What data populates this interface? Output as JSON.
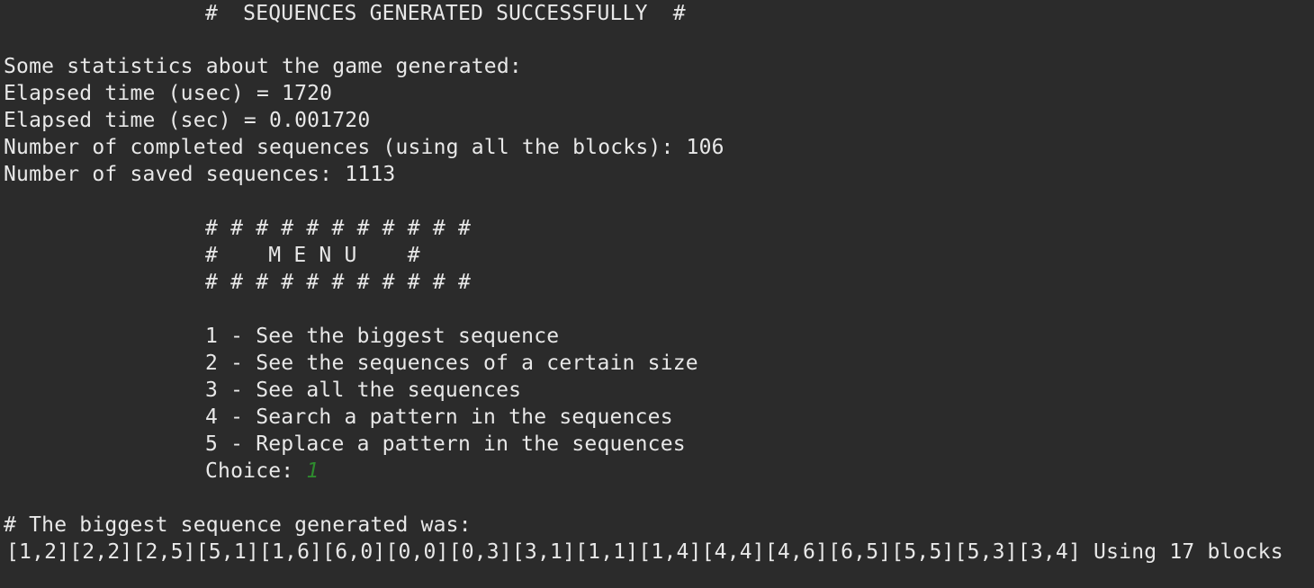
{
  "terminal": {
    "header": "#  SEQUENCES GENERATED SUCCESSFULLY  #",
    "stats": {
      "heading": "Some statistics about the game generated:",
      "usec_line": "Elapsed time (usec) = 1720",
      "sec_line": "Elapsed time (sec) = 0.001720",
      "completed_line": "Number of completed sequences (using all the blocks): 106",
      "saved_line": "Number of saved sequences: 1113"
    },
    "menu": {
      "border_top": "# # # # # # # # # # #",
      "title_line": "#    M E N U    #",
      "border_bottom": "# # # # # # # # # # #",
      "options": [
        "1 - See the biggest sequence",
        "2 - See the sequences of a certain size",
        "3 - See all the sequences",
        "4 - Search a pattern in the sequences",
        "5 - Replace a pattern in the sequences"
      ],
      "choice_prompt": "Choice: ",
      "choice_value": "1"
    },
    "result": {
      "heading": "# The biggest sequence generated was:",
      "sequence": "[1,2][2,2][2,5][5,1][1,6][6,0][0,0][0,3][3,1][1,1][1,4][4,4][4,6][6,5][5,5][5,3][3,4] Using 17 blocks"
    },
    "colors": {
      "background": "#2b2b2b",
      "text": "#e8e8e8",
      "input": "#2e8b2e"
    }
  }
}
